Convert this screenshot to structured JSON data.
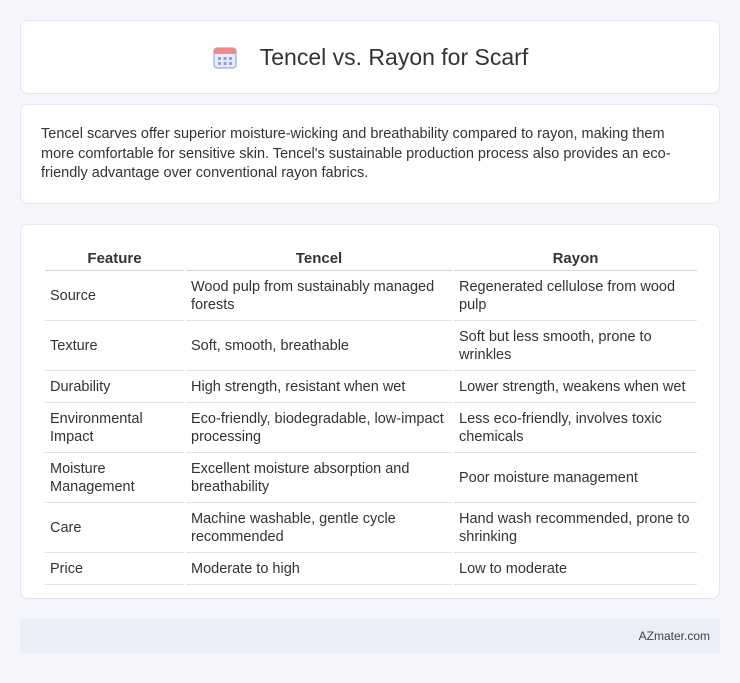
{
  "header": {
    "title": "Tencel vs. Rayon for Scarf",
    "icon": "calendar-icon",
    "icon_color": "#7b8fe0"
  },
  "summary": {
    "text": "Tencel scarves offer superior moisture-wicking and breathability compared to rayon, making them more comfortable for sensitive skin. Tencel's sustainable production process also provides an eco-friendly advantage over conventional rayon fabrics."
  },
  "table": {
    "columns": [
      "Feature",
      "Tencel",
      "Rayon"
    ],
    "rows": [
      [
        "Source",
        "Wood pulp from sustainably managed forests",
        "Regenerated cellulose from wood pulp"
      ],
      [
        "Texture",
        "Soft, smooth, breathable",
        "Soft but less smooth, prone to wrinkles"
      ],
      [
        "Durability",
        "High strength, resistant when wet",
        "Lower strength, weakens when wet"
      ],
      [
        "Environmental Impact",
        "Eco-friendly, biodegradable, low-impact processing",
        "Less eco-friendly, involves toxic chemicals"
      ],
      [
        "Moisture Management",
        "Excellent moisture absorption and breathability",
        "Poor moisture management"
      ],
      [
        "Care",
        "Machine washable, gentle cycle recommended",
        "Hand wash recommended, prone to shrinking"
      ],
      [
        "Price",
        "Moderate to high",
        "Low to moderate"
      ]
    ]
  },
  "footer": {
    "brand": "AZmater.com"
  }
}
